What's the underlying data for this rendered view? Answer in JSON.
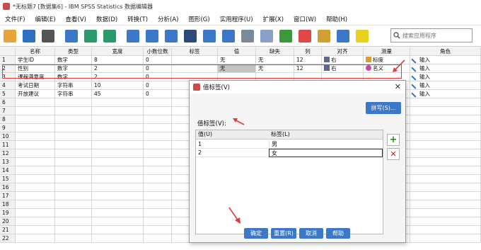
{
  "window": {
    "title": "*无标题7 [数据集6] - IBM SPSS Statistics 数据编辑器"
  },
  "menu": [
    "文件(F)",
    "编辑(E)",
    "查看(V)",
    "数据(D)",
    "转换(T)",
    "分析(A)",
    "图形(G)",
    "实用程序(U)",
    "扩展(X)",
    "窗口(W)",
    "帮助(H)"
  ],
  "toolbar": {
    "icons": [
      "open-folder-icon",
      "save-icon",
      "print-icon",
      "recall-dialog-icon",
      "undo-icon",
      "redo-icon",
      "goto-case-icon",
      "goto-variable-icon",
      "variables-icon",
      "find-icon",
      "insert-cases-icon",
      "insert-variable-icon",
      "split-file-icon",
      "weight-cases-icon",
      "select-cases-icon",
      "value-labels-icon",
      "use-variable-sets-icon",
      "show-all-variables-icon",
      "spelling-icon"
    ],
    "colors": [
      "#e8a33a",
      "#2f6fc4",
      "#555555",
      "#3c78c8",
      "#2b9a6a",
      "#2b9a6a",
      "#3c78c8",
      "#3c78c8",
      "#3c78c8",
      "#2c4a7a",
      "#3c78c8",
      "#3c78c8",
      "#7a8a99",
      "#8aa0c8",
      "#3a9a3a",
      "#e04848",
      "#d0a030",
      "#3c78c8",
      "#e8d020"
    ],
    "search_placeholder": "搜索应用程序"
  },
  "grid": {
    "columns": [
      "名称",
      "类型",
      "宽度",
      "小数位数",
      "标签",
      "值",
      "缺失",
      "列",
      "对齐",
      "测量",
      "角色"
    ],
    "rows": [
      {
        "num": "1",
        "name": "学生ID",
        "type": "数字",
        "width": "8",
        "decimals": "0",
        "label": "",
        "values": "无",
        "missing": "无",
        "columns": "12",
        "align": "右",
        "measure": "标度",
        "role": "输入"
      },
      {
        "num": "2",
        "name": "性别",
        "type": "数字",
        "width": "2",
        "decimals": "0",
        "label": "",
        "values": "无",
        "missing": "无",
        "columns": "12",
        "align": "右",
        "measure": "名义",
        "role": "输入"
      },
      {
        "num": "3",
        "name": "课程满意度",
        "type": "数字",
        "width": "2",
        "decimals": "0",
        "label": "",
        "values": "",
        "missing": "",
        "columns": "",
        "align": "",
        "measure": "",
        "role": "输入"
      },
      {
        "num": "4",
        "name": "考试日期",
        "type": "字符串",
        "width": "10",
        "decimals": "0",
        "label": "",
        "values": "",
        "missing": "",
        "columns": "",
        "align": "",
        "measure": "",
        "role": "输入"
      },
      {
        "num": "5",
        "name": "开放建议",
        "type": "字符串",
        "width": "45",
        "decimals": "0",
        "label": "",
        "values": "",
        "missing": "",
        "columns": "",
        "align": "",
        "measure": "",
        "role": "输入"
      },
      {
        "num": "6"
      },
      {
        "num": "7"
      },
      {
        "num": "8"
      },
      {
        "num": "9"
      },
      {
        "num": "10"
      },
      {
        "num": "11"
      },
      {
        "num": "12"
      },
      {
        "num": "13"
      },
      {
        "num": "14"
      },
      {
        "num": "15"
      },
      {
        "num": "16"
      },
      {
        "num": "17"
      },
      {
        "num": "18"
      },
      {
        "num": "19"
      },
      {
        "num": "20"
      },
      {
        "num": "21"
      },
      {
        "num": "22"
      }
    ]
  },
  "dialog": {
    "title": "值标签(V)",
    "spell_button": "拼写(S)...",
    "value_labels_heading": "值标签(V):",
    "table_headers": [
      "值(U)",
      "标签(L)"
    ],
    "table_rows": [
      {
        "value": "1",
        "label": "男"
      },
      {
        "value": "2",
        "label": "女"
      }
    ],
    "buttons": [
      "确定",
      "重置(R)",
      "取消",
      "帮助"
    ]
  },
  "colors": {
    "accent": "#3c78c8",
    "highlight": "#e03a3a",
    "add": "#1e8a1e",
    "remove": "#d01818"
  }
}
